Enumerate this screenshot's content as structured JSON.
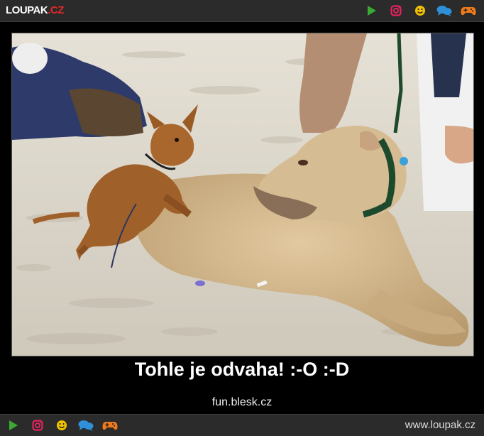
{
  "header": {
    "logo_main": "LOUPAK",
    "logo_tld": ".CZ",
    "icons": [
      "play-icon",
      "instagram-icon",
      "smiley-icon",
      "chat-icon",
      "gamepad-icon"
    ]
  },
  "post": {
    "caption": "Tohle je odvaha! :-O :-D",
    "source": "fun.blesk.cz"
  },
  "footer": {
    "site_url": "www.loupak.cz",
    "icons": [
      "play-icon",
      "instagram-icon",
      "smiley-icon",
      "chat-icon",
      "gamepad-icon"
    ]
  },
  "colors": {
    "play": "#3aaa35",
    "instagram": "#e0245e",
    "smiley": "#f2c200",
    "chat": "#2f8fd8",
    "gamepad": "#f07a1a",
    "bar_bg": "#2b2b2b",
    "logo_accent": "#e8262a"
  }
}
